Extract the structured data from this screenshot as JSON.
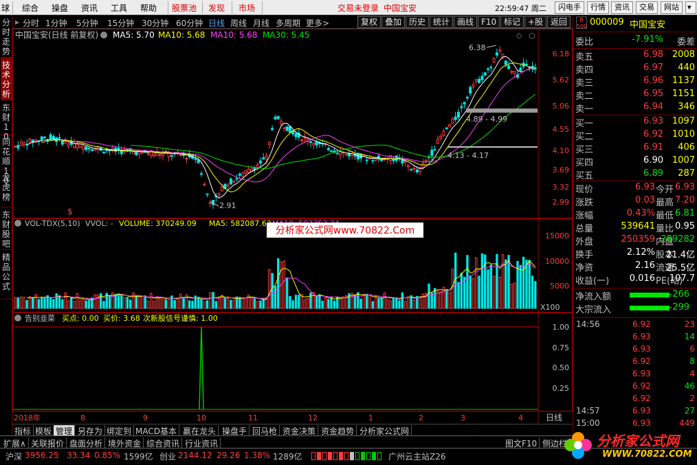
{
  "menubar": {
    "items": [
      "球",
      "综合",
      "操盘",
      "资讯",
      "工具",
      "帮助"
    ],
    "red_items": [
      "股票池",
      "发现"
    ],
    "market": "市场",
    "trade_status": "交易未登录",
    "stock_name": "中国宝安",
    "time": "22:59:47 周二",
    "buttons": [
      "闪电手",
      "行情",
      "资讯",
      "交易",
      "网站"
    ]
  },
  "toolbar": {
    "periods": [
      "分时",
      "1分钟",
      "5分钟",
      "15分钟",
      "30分钟",
      "60分钟",
      "日线",
      "周线",
      "月线",
      "多周期",
      "更多>"
    ],
    "active_period": "日线",
    "buttons": [
      "复权",
      "叠加",
      "历史",
      "统计",
      "画线",
      "F10",
      "标记",
      "+股",
      "返回"
    ]
  },
  "left_tabs": [
    {
      "label": "分时走势",
      "active": false
    },
    {
      "label": "技术分析",
      "active": true
    },
    {
      "label": "东财10",
      "active": false
    },
    {
      "label": "同花顺10",
      "active": false
    },
    {
      "label": "龙虎榜",
      "active": false
    },
    {
      "label": "东财股吧",
      "active": false
    },
    {
      "label": "精品公式",
      "active": false
    }
  ],
  "price_panel": {
    "title": "中国宝安(日线 前复权)",
    "ma5": "MA5: 5.70",
    "ma10": "MA10: 5.68",
    "ma20": "MA10: 5.68",
    "ma30": "MA30: 5.45",
    "y_ticks": [
      "6.18",
      "5.62",
      "5.06",
      "4.55",
      "4.10",
      "3.69",
      "3.32",
      "2.99"
    ],
    "annot_high": "6.38",
    "annot_low": "2.91",
    "zone1": "4.89 - 4.99",
    "zone2": "4.13 - 4.17"
  },
  "volume_panel": {
    "title": "VOL-TDX(5,10)",
    "vvol": "VVOL: -",
    "volume": "VOLUME: 370249.09",
    "ma5": "MA5: 582087.63",
    "ma10": "MA10: 593353.34",
    "y_ticks": [
      "15000",
      "10000",
      "5000"
    ],
    "unit": "X100"
  },
  "indicator_panel": {
    "title": "告别韭菜",
    "buy_point": "买点: 0.00",
    "buy_price": "买价: 3.68",
    "new_stock": "次新股信号谨慎: 1.00",
    "y_ticks": [
      "1.00",
      "0.75",
      "0.50",
      "0.25"
    ]
  },
  "watermark": {
    "text": "分析家公式网www.70822.Com",
    "logo_text": "分析家公式网",
    "logo_url": "WWW.70822.COM"
  },
  "x_axis": {
    "labels": [
      "2018年",
      "8",
      "9",
      "10",
      "11",
      "12",
      "1",
      "2",
      "3",
      "4"
    ],
    "period_label": "日线"
  },
  "chart_tabs": [
    "指标",
    "模板",
    "管理",
    "另存为",
    "绑定到",
    "MACD基本",
    "赢在龙头",
    "操盘手",
    "回马枪",
    "资金决策",
    "资金趋势",
    "分析家公式网"
  ],
  "chart_tabs_active": "管理",
  "bottom_tabs": [
    "扩展∧",
    "关联报价",
    "盘面分析",
    "境外资金",
    "综合资讯",
    "行业资讯"
  ],
  "bottom_right": [
    "图文F10",
    "侧边栏"
  ],
  "quote": {
    "code": "000009",
    "name": "中国宝安",
    "badge_top": "R",
    "badge_bottom": "500",
    "weibi_label": "委比",
    "weibi": "-7.91%",
    "weicha_label": "委差",
    "asks": [
      {
        "label": "卖五",
        "price": "6.98",
        "vol": "2008"
      },
      {
        "label": "卖四",
        "price": "6.97",
        "vol": "440"
      },
      {
        "label": "卖三",
        "price": "6.96",
        "vol": "1137"
      },
      {
        "label": "卖二",
        "price": "6.95",
        "vol": "1151"
      },
      {
        "label": "卖一",
        "price": "6.94",
        "vol": "346"
      }
    ],
    "bids": [
      {
        "label": "买一",
        "price": "6.93",
        "vol": "1097"
      },
      {
        "label": "买二",
        "price": "6.92",
        "vol": "1010"
      },
      {
        "label": "买三",
        "price": "6.91",
        "vol": "406"
      },
      {
        "label": "买四",
        "price": "6.90",
        "vol": "1007"
      },
      {
        "label": "买五",
        "price": "6.89",
        "vol": "287"
      }
    ],
    "stats": [
      {
        "l1": "现价",
        "v1": "6.93",
        "l2": "今开",
        "v2": "6.93",
        "c1": "red",
        "c2": "red"
      },
      {
        "l1": "涨跌",
        "v1": "0.03",
        "l2": "最高",
        "v2": "7.20",
        "c1": "red",
        "c2": "red"
      },
      {
        "l1": "涨幅",
        "v1": "0.43%",
        "l2": "最低",
        "v2": "6.81",
        "c1": "red",
        "c2": "green"
      },
      {
        "l1": "总量",
        "v1": "539641",
        "l2": "量比",
        "v2": "0.95",
        "c1": "yellow",
        "c2": "white"
      },
      {
        "l1": "外盘",
        "v1": "250359",
        "l2": "内盘",
        "v2": "289282",
        "c1": "red",
        "c2": "green"
      },
      {
        "l1": "换手",
        "v1": "2.12%",
        "l2": "股本",
        "v2": "21.4亿",
        "c1": "white",
        "c2": "white"
      },
      {
        "l1": "净资",
        "v1": "2.16",
        "l2": "流通",
        "v2": "25.5亿",
        "c1": "white",
        "c2": "white"
      },
      {
        "l1": "收益(一)",
        "v1": "0.016",
        "l2": "PE(动)",
        "v2": "107.7",
        "c1": "white",
        "c2": "white"
      }
    ],
    "flows": [
      {
        "label": "净流入额",
        "value": "-266"
      },
      {
        "label": "大宗流入",
        "value": "-299"
      }
    ],
    "ticks": [
      {
        "time": "14:56",
        "price": "6.92",
        "vol": "23"
      },
      {
        "time": "",
        "price": "6.93",
        "vol": "14"
      },
      {
        "time": "",
        "price": "6.93",
        "vol": "6"
      },
      {
        "time": "",
        "price": "6.92",
        "vol": "8"
      },
      {
        "time": "",
        "price": "6.93",
        "vol": "4"
      },
      {
        "time": "",
        "price": "6.92",
        "vol": "46"
      },
      {
        "time": "",
        "price": "6.92",
        "vol": "2"
      },
      {
        "time": "14:57",
        "price": "6.93",
        "vol": "27"
      },
      {
        "time": "15:00",
        "price": "6.93",
        "vol": "449"
      }
    ]
  },
  "status": {
    "sh_label": "沪深",
    "sh_index": "3956.25",
    "sh_change": "33.34",
    "sh_pct": "0.85%",
    "sh_amount": "1599亿",
    "cy_label": "创业",
    "cy_index": "2144.12",
    "cy_change": "29.26",
    "cy_pct": "1.38%",
    "cy_amount": "1289亿",
    "server": "广州云主站Z26"
  }
}
